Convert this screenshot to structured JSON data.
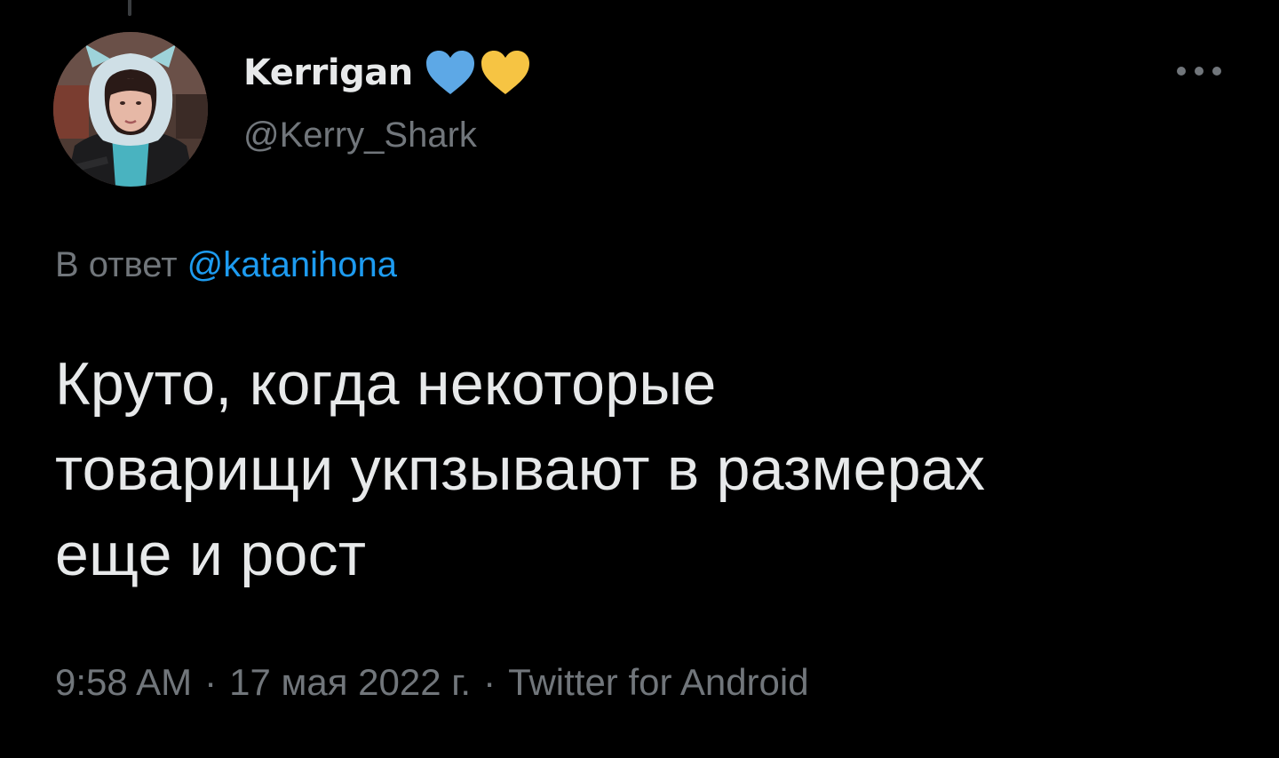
{
  "tweet": {
    "author": {
      "display_name": "Kerrigan",
      "handle": "@Kerry_Shark",
      "badges": [
        "blue-heart-icon",
        "yellow-heart-icon"
      ],
      "avatar_icon": "profile-photo"
    },
    "reply": {
      "prefix": "В ответ",
      "mention": "@katanihona"
    },
    "text": "Круто, когда некоторые\nтоварищи укпзывают в размерах\nеще и рост",
    "meta": {
      "time": "9:58 AM",
      "date": "17 мая 2022 г.",
      "source": "Twitter for Android",
      "separator": "·"
    },
    "menu_icon": "more-options-icon"
  },
  "colors": {
    "background": "#000000",
    "primary_text": "#e7e9ea",
    "secondary_text": "#71767b",
    "link": "#1d9bf0",
    "blue_heart": "#5da8e6",
    "yellow_heart": "#f6c443"
  }
}
